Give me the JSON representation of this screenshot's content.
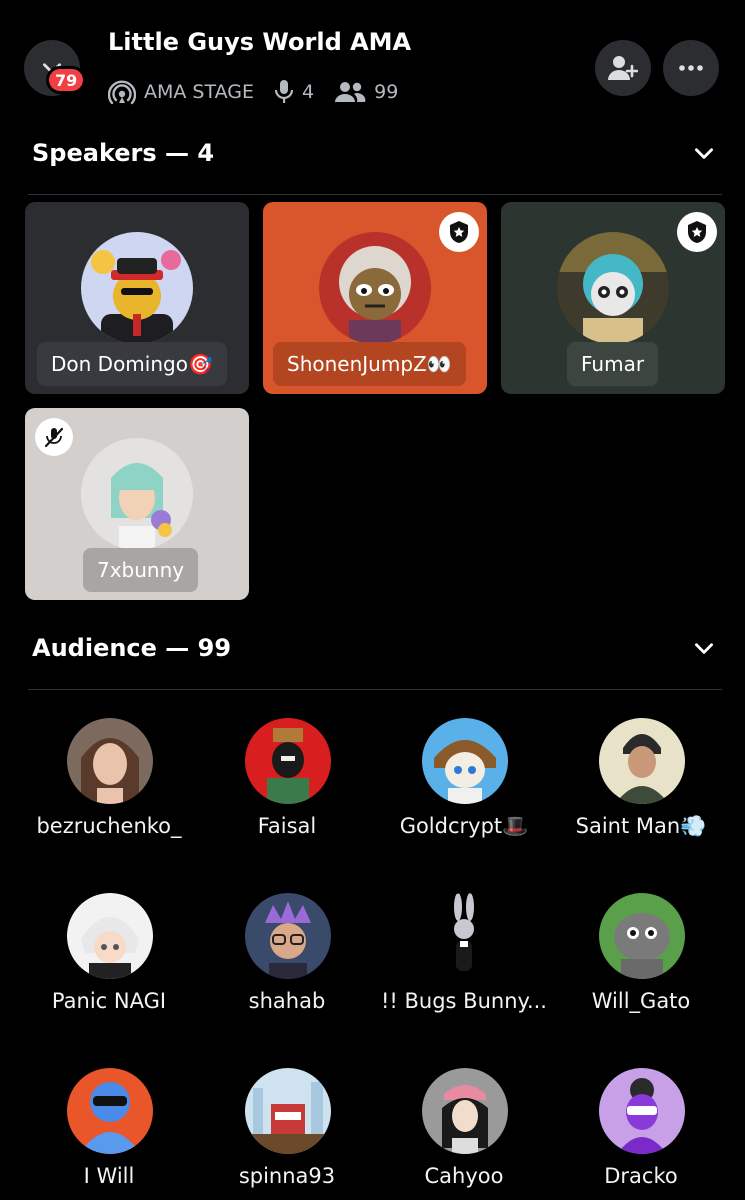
{
  "header": {
    "title": "Little Guys World AMA",
    "unread_badge": "79",
    "stage_label": "AMA STAGE",
    "speaker_count": "4",
    "listener_count": "99",
    "icons": {
      "back": "chevron-down-icon",
      "stage": "stage-broadcast-icon",
      "mic": "microphone-icon",
      "people": "people-icon",
      "invite": "add-friend-icon",
      "more": "more-horizontal-icon"
    }
  },
  "speakers_section": {
    "label": "Speakers — 4"
  },
  "speakers": [
    {
      "name": "Don Domingo",
      "emoji": "🎯",
      "tile_color": "#2b2d31",
      "moderator": false,
      "muted": false
    },
    {
      "name": "ShonenJumpZ",
      "emoji": "👀",
      "tile_color": "#d9552b",
      "moderator": true,
      "muted": false
    },
    {
      "name": "Fumar",
      "emoji": "",
      "tile_color": "#2c3530",
      "moderator": true,
      "muted": false
    },
    {
      "name": "7xbunny",
      "emoji": "",
      "tile_color": "#d2cfcd",
      "moderator": false,
      "muted": true
    }
  ],
  "audience_section": {
    "label": "Audience — 99"
  },
  "audience": [
    {
      "name": "bezruchenko_",
      "emoji": ""
    },
    {
      "name": "Faisal",
      "emoji": ""
    },
    {
      "name": "Goldcrypt",
      "emoji": "🎩"
    },
    {
      "name": "Saint Man",
      "emoji": "💨"
    },
    {
      "name": "Panic NAGI",
      "emoji": ""
    },
    {
      "name": "shahab",
      "emoji": ""
    },
    {
      "name": "!! Bugs Bunny...",
      "emoji": ""
    },
    {
      "name": "Will_Gato",
      "emoji": ""
    },
    {
      "name": "I Will",
      "emoji": ""
    },
    {
      "name": "spinna93",
      "emoji": ""
    },
    {
      "name": "Cahyoo",
      "emoji": ""
    },
    {
      "name": "Dracko",
      "emoji": ""
    }
  ],
  "colors": {
    "background": "#000000",
    "surface": "#2b2d31",
    "badge_red": "#f23f43",
    "muted_text": "#b5bac1"
  }
}
